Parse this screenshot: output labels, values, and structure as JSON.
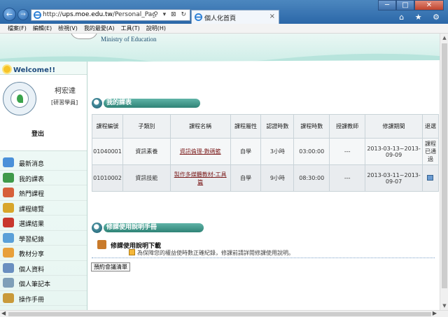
{
  "browser": {
    "url_prefix": "http://",
    "url_host": "ups.moe.edu.tw",
    "url_path": "/Personal_Page/index.ph",
    "url_controls": "⚲ ▾ ⊠ ↻",
    "tab_title": "個人化首頁",
    "tab_close": "×",
    "window_buttons": [
      "─",
      "□",
      "✕"
    ],
    "toolbar_icons": "⌂ ★ ⚙",
    "back": "←",
    "forward": "→",
    "menu": [
      "檔案(F)",
      "編輯(E)",
      "檢視(V)",
      "我的最愛(A)",
      "工具(T)",
      "說明(H)"
    ]
  },
  "header": {
    "ministry": "Ministry of Education"
  },
  "sidebar": {
    "welcome": "Welcome!!",
    "user_name": "柯宏達",
    "user_role": "[研習學員]",
    "logout": "登出",
    "menu": [
      {
        "label": "最新消息",
        "icon": "cloud-icon",
        "color": "#4a90d9"
      },
      {
        "label": "我的課表",
        "icon": "people-icon",
        "color": "#3f9a4a"
      },
      {
        "label": "熱門課程",
        "icon": "fire-icon",
        "color": "#d6603a"
      },
      {
        "label": "課程總覽",
        "icon": "book-icon",
        "color": "#d8a62a"
      },
      {
        "label": "選課結果",
        "icon": "calendar-icon",
        "color": "#c8372d"
      },
      {
        "label": "學習紀錄",
        "icon": "record-icon",
        "color": "#5aa0d8"
      },
      {
        "label": "教材分享",
        "icon": "share-icon",
        "color": "#e8a03a"
      },
      {
        "label": "個人資料",
        "icon": "user-icon",
        "color": "#6a8fc0"
      },
      {
        "label": "個人筆記本",
        "icon": "notebook-icon",
        "color": "#7f9fb8"
      },
      {
        "label": "操作手冊",
        "icon": "manual-icon",
        "color": "#c99a3a"
      }
    ]
  },
  "main": {
    "schedule_title": "我的課表",
    "columns": [
      "課程編號",
      "子類別",
      "課程名稱",
      "課程屬性",
      "認證時數",
      "課程時數",
      "授課教師",
      "修課期間",
      "退選"
    ],
    "rows": [
      {
        "id": "01040001",
        "category": "資訊素養",
        "name": "資訊倫理-數碼籃",
        "type": "自學",
        "cert_hours": "3小時",
        "duration": "03:00:00",
        "teacher": "---",
        "period": "2013-03-13~2013-09-09",
        "drop": "課程已通過"
      },
      {
        "id": "01010002",
        "category": "資訊技能",
        "name": "製作多媒體教材-工具篇",
        "type": "自學",
        "cert_hours": "9小時",
        "duration": "08:30:00",
        "teacher": "---",
        "period": "2013-03-11~2013-09-07",
        "drop": ""
      }
    ],
    "manual_section_title": "修課使用說明手冊",
    "manual_download": "修課使用說明下載",
    "notice": "為保障您的權益使時數正確紀錄，修課前請詳閱修課使用說明。",
    "reserve_button": "預約會議清單"
  }
}
